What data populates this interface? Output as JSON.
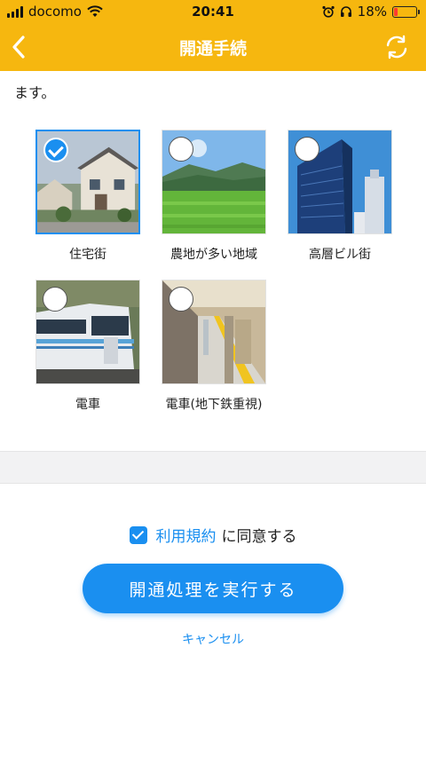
{
  "status_bar": {
    "carrier": "docomo",
    "time": "20:41",
    "battery": "18%",
    "battery_fraction": 0.18,
    "battery_low_color": "#ff3b30"
  },
  "header": {
    "title": "開通手続",
    "back_icon": "chevron-left-icon",
    "refresh_icon": "refresh-icon",
    "color": "#f6b70f"
  },
  "intro": {
    "line_visible": "ます。"
  },
  "options": [
    {
      "label": "住宅街",
      "selected": true
    },
    {
      "label": "農地が多い地域",
      "selected": false
    },
    {
      "label": "高層ビル街",
      "selected": false
    },
    {
      "label": "電車",
      "selected": false
    },
    {
      "label": "電車(地下鉄重視)",
      "selected": false
    }
  ],
  "agreement": {
    "checked": true,
    "link_text": "利用規約",
    "suffix": "に同意する"
  },
  "buttons": {
    "execute": "開通処理を実行する",
    "cancel": "キャンセル"
  },
  "accent_color": "#1a8ff0"
}
